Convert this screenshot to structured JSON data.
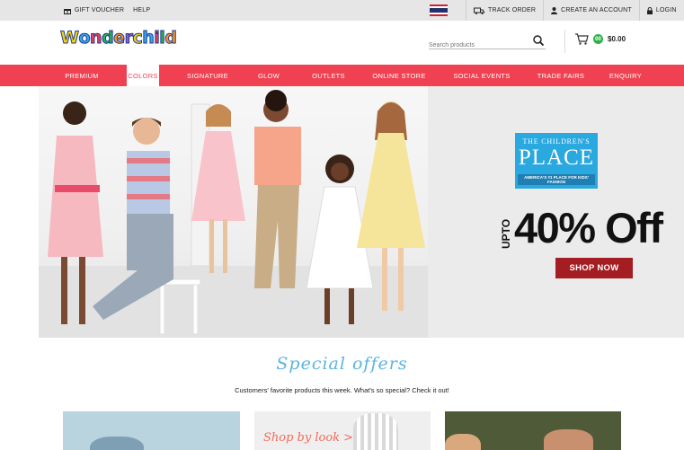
{
  "topbar": {
    "gift_voucher": "GIFT VOUCHER",
    "help": "HELP",
    "track_order": "TRACK ORDER",
    "create_account": "CREATE AN ACCOUNT",
    "login": "LOGIN"
  },
  "header": {
    "logo_text": "Wonderchild",
    "search_placeholder": "Search products",
    "cart_count": "00",
    "cart_total": "$0.00"
  },
  "nav": {
    "items": [
      "PREMIUM",
      "COLORS",
      "SIGNATURE",
      "GLOW",
      "OUTLETS",
      "ONLINE STORE",
      "SOCIAL EVENTS",
      "TRADE FAIRS",
      "ENQUIRY"
    ],
    "active": "COLORS"
  },
  "hero": {
    "brand_line1": "THE CHILDREN'S",
    "brand_line2": "PLACE",
    "brand_tagline": "AMERICA'S #1 PLACE FOR KIDS' FASHION",
    "upto": "UPTO",
    "discount": "40% Off",
    "cta": "SHOP NOW"
  },
  "offers": {
    "title": "Special offers",
    "subtitle": "Customers' favorite products this week. What's so special? Check it out!",
    "tile_text": "Shop by look >"
  },
  "colors": {
    "nav_red": "#f04152",
    "brand_blue": "#2aa8e0",
    "cta_red": "#a31d22",
    "special_blue": "#5ab4e4",
    "badge_green": "#2db24a"
  }
}
